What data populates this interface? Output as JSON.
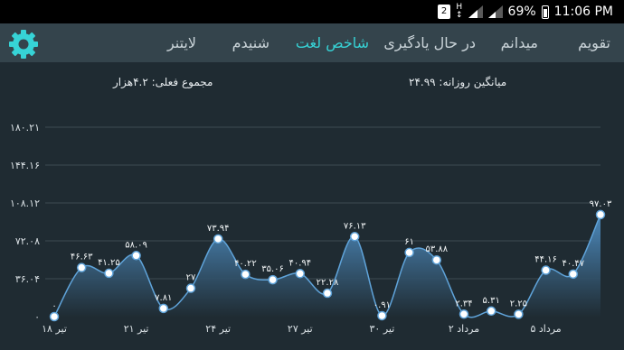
{
  "status": {
    "sim_label": "2",
    "network": "H",
    "battery": "69%",
    "time": "11:06 PM"
  },
  "tabs": [
    {
      "label": "تقویم"
    },
    {
      "label": "میدانم"
    },
    {
      "label": "در حال یادگیری"
    },
    {
      "label": "شاخص لغت",
      "active": true
    },
    {
      "label": "شنیدم"
    },
    {
      "label": "لایتنر"
    }
  ],
  "summary": {
    "total": "مجموع فعلی: ۴.۲هزار",
    "daily_average": "میانگین روزانه: ۲۴.۹۹"
  },
  "colors": {
    "accent": "#36d3d6",
    "line": "#5fa3d9",
    "background": "#1f2b32",
    "tabbar": "#34444c"
  },
  "icons": {
    "settings": "gear-icon"
  },
  "chart_data": {
    "type": "area",
    "y_ticks": [
      "۰",
      "۳۶.۰۴",
      "۷۲.۰۸",
      "۱۰۸.۱۲",
      "۱۴۴.۱۶",
      "۱۸۰.۲۱"
    ],
    "ylim": [
      0,
      180.21
    ],
    "x_tick_labels": [
      {
        "index": 0,
        "label": "۱۸ تیر"
      },
      {
        "index": 3,
        "label": "۲۱ تیر"
      },
      {
        "index": 6,
        "label": "۲۴ تیر"
      },
      {
        "index": 9,
        "label": "۲۷ تیر"
      },
      {
        "index": 12,
        "label": "۳۰ تیر"
      },
      {
        "index": 15,
        "label": "۲ مرداد"
      },
      {
        "index": 18,
        "label": "۵ مرداد"
      }
    ],
    "values": [
      0,
      46.63,
      41.25,
      58.09,
      7.81,
      27,
      73.94,
      40.22,
      35.06,
      40.94,
      22.28,
      76.13,
      0.91,
      61,
      53.88,
      2.34,
      5.31,
      2.25,
      44.16,
      40.47,
      97.03
    ],
    "labels": [
      "۰",
      "۴۶.۶۳",
      "۴۱.۲۵",
      "۵۸.۰۹",
      "۷.۸۱",
      "۲۷",
      "۷۳.۹۴",
      "۴۰.۲۲",
      "۳۵.۰۶",
      "۴۰.۹۴",
      "۲۲.۲۸",
      "۷۶.۱۳",
      "۰.۹۱",
      "۶۱",
      "۵۳.۸۸",
      "۲.۳۴",
      "۵.۳۱",
      "۲.۲۵",
      "۴۴.۱۶",
      "۴۰.۴۷",
      "۹۷.۰۳"
    ],
    "grid": true,
    "legend": "none"
  }
}
